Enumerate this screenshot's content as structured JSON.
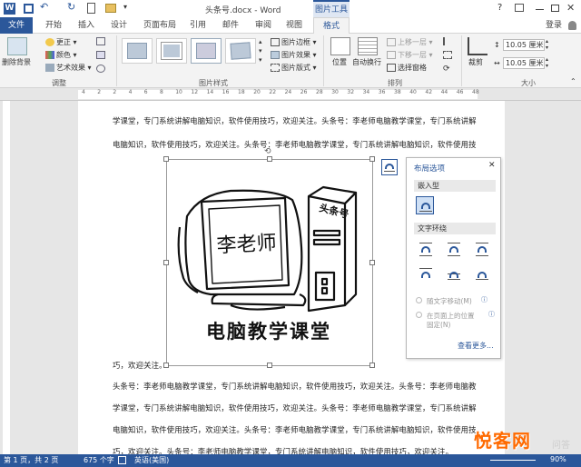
{
  "title_bar": {
    "doc_title": "头条号.docx - Word",
    "help": "?"
  },
  "tabs": {
    "file": "文件",
    "home": "开始",
    "insert": "插入",
    "design": "设计",
    "layout": "页面布局",
    "references": "引用",
    "mailings": "邮件",
    "review": "审阅",
    "view": "视图",
    "picture_tools": "图片工具",
    "format": "格式",
    "login": "登录"
  },
  "ribbon": {
    "remove_bg": "删除背景",
    "corrections": "更正",
    "color": "颜色",
    "artistic": "艺术效果",
    "group_adjust": "调整",
    "border": "图片边框",
    "effects": "图片效果",
    "layout": "图片版式",
    "group_styles": "图片样式",
    "position": "位置",
    "wrap_text": "自动换行",
    "bring_forward": "上移一层",
    "send_backward": "下移一层",
    "selection_pane": "选择窗格",
    "group_arrange": "排列",
    "crop": "裁剪",
    "height": "10.05 厘米",
    "width": "10.05 厘米",
    "group_size": "大小"
  },
  "ruler": {
    "numbers": [
      "4",
      "2",
      "2",
      "4",
      "6",
      "8",
      "10",
      "12",
      "14",
      "16",
      "18",
      "20",
      "22",
      "24",
      "26",
      "28",
      "30",
      "32",
      "34",
      "36",
      "38",
      "40",
      "42",
      "44",
      "46",
      "48"
    ]
  },
  "document": {
    "lines": [
      "学课堂，专门系统讲解电脑知识，软件使用技巧，欢迎关注。头条号：李老师电脑教学课堂，专门系统讲解",
      "电脑知识，软件使用技巧，欢迎关注。头条号：李老师电脑教学课堂，专门系统讲解电脑知识，软件使用技",
      "巧，欢迎关注。",
      "头条号：李老师电脑教学课堂，专门系统讲解电脑知识，软件使用技巧，欢迎关注。头条号：李老师电脑教",
      "学课堂，专门系统讲解电脑知识，软件使用技巧，欢迎关注。头条号：李老师电脑教学课堂，专门系统讲解",
      "电脑知识，软件使用技巧，欢迎关注。头条号：李老师电脑教学课堂，专门系统讲解电脑知识，软件使用技",
      "巧，欢迎关注。头条号：李老师电脑教学课堂，专门系统讲解电脑知识，软件使用技巧，欢迎关注。"
    ]
  },
  "image": {
    "screen_text": "李老师",
    "tower_text": "头条号",
    "caption": "电脑教学课堂"
  },
  "layout_panel": {
    "title": "布局选项",
    "inline": "嵌入型",
    "wrap": "文字环绕",
    "move_with_text": "随文字移动(M)",
    "fix_position_1": "在页面上的位置",
    "fix_position_2": "固定(N)",
    "see_more": "查看更多..."
  },
  "status": {
    "page": "第 1 页，共 2 页",
    "words": "675 个字",
    "language": "英语(美国)",
    "zoom": "90%"
  },
  "watermark": {
    "text": "悦客网",
    "subtext": "问答"
  },
  "colors": {
    "accent": "#2b579a"
  }
}
